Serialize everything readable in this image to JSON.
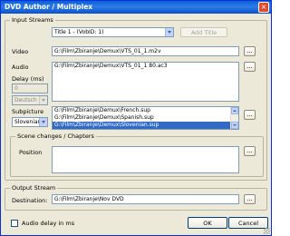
{
  "window": {
    "title": "DVD Author / Multiplex",
    "close_glyph": "×"
  },
  "input_streams": {
    "legend": "Input Streams",
    "title_combo": "Title 1 - (VobID: 1)",
    "add_title_label": "Add Title",
    "video_label": "Video",
    "video_path": "G:\\Film\\Zbiranje\\Demux\\VTS_01_1.m2v",
    "audio_label": "Audio",
    "audio_path": "G:\\Film\\Zbiranje\\Demux\\VTS_01_1 80.ac3",
    "delay_label": "Delay (ms)",
    "delay_value": "0",
    "audio_lang": "Deutsch",
    "subpicture_label": "Subpicture",
    "subpicture_lang": "Slovenian",
    "subpicture_items": [
      "G:\\Film\\Zbiranje\\Demux\\French.sup",
      "G:\\Film\\Zbiranje\\Demux\\Spanish.sup",
      "G:\\Film\\Zbiranje\\Demux\\Slovenian.sup"
    ],
    "subpicture_selected_index": 2,
    "browse_glyph": "..."
  },
  "scene": {
    "legend": "Scene changes / Chapters",
    "position_label": "Position"
  },
  "output": {
    "legend": "Output Stream",
    "destination_label": "Destination:",
    "destination_path": "G:\\Film\\Zbiranje\\Nov DVD"
  },
  "footer": {
    "audio_delay_label": "Audio delay in ms",
    "ok_label": "OK",
    "cancel_label": "Cancel"
  }
}
